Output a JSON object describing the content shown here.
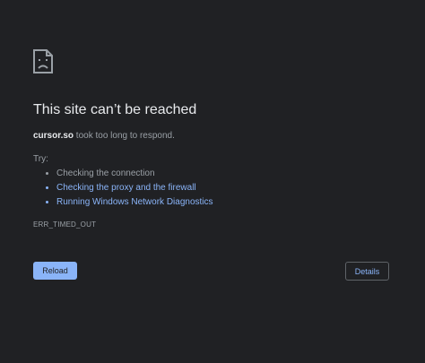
{
  "error": {
    "title": "This site can’t be reached",
    "host": "cursor.so",
    "message": " took too long to respond.",
    "try_label": "Try:",
    "suggestions": [
      "Checking the connection",
      "Checking the proxy and the firewall",
      "Running Windows Network Diagnostics"
    ],
    "code": "ERR_TIMED_OUT"
  },
  "buttons": {
    "reload_label": "Reload",
    "details_label": "Details"
  },
  "colors": {
    "background": "#202124",
    "title_text": "#e8eaed",
    "body_text": "#9aa0a6",
    "link": "#8ab4f8",
    "primary_button": "#8ab4f8",
    "button_border": "#5f6368"
  },
  "icon": "sad-page-icon"
}
